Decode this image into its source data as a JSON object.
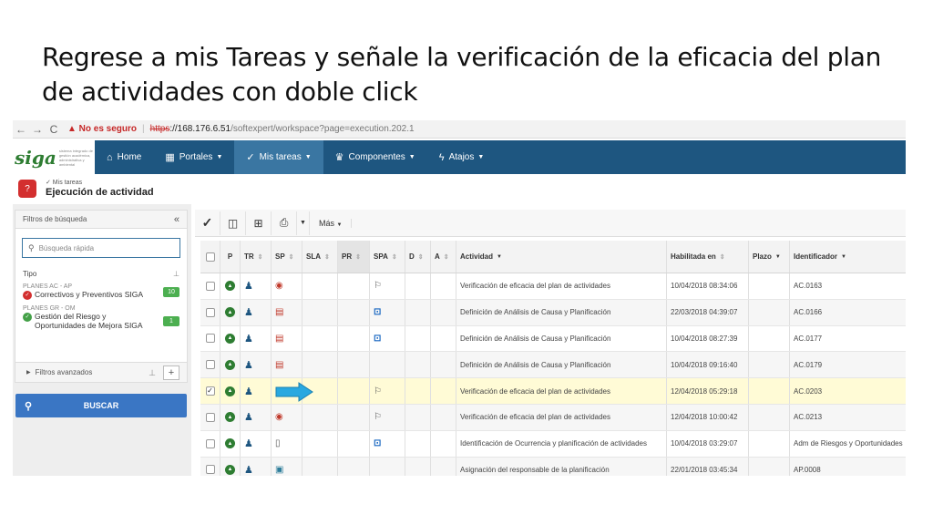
{
  "slide": {
    "title": "Regrese a mis Tareas y señale la verificación de la eficacia del plan de actividades con doble click"
  },
  "browser": {
    "back": "←",
    "forward": "→",
    "reload": "C",
    "security_warning": "▲ No es seguro",
    "separator": "|",
    "url_scheme": "https",
    "url_host": "://168.176.6.51",
    "url_path": "/softexpert/workspace?page=execution.202.1"
  },
  "nav": {
    "logo": "siga",
    "logo_subtitle": "sistema integrado de gestión académica, administrativa y ambiental",
    "items": [
      {
        "label": "Home",
        "icon": "home-icon",
        "glyph": "⌂"
      },
      {
        "label": "Portales",
        "icon": "grid-icon",
        "glyph": "▦"
      },
      {
        "label": "Mis tareas",
        "icon": "check-icon",
        "glyph": "✓"
      },
      {
        "label": "Componentes",
        "icon": "trophy-icon",
        "glyph": "♛"
      },
      {
        "label": "Atajos",
        "icon": "bolt-icon",
        "glyph": "ϟ"
      }
    ]
  },
  "breadcrumb": {
    "parent": "✓ Mis tareas",
    "title": "Ejecución de actividad"
  },
  "filters": {
    "header": "Filtros de búsqueda",
    "collapse": "«",
    "search_placeholder": "Búsqueda rápida",
    "tipo_label": "Tipo",
    "groups": [
      {
        "label": "PLANES AC - AP",
        "name": "Correctivos y Preventivos SIGA",
        "count": "10",
        "status": "red"
      },
      {
        "label": "PLANES GR - OM",
        "name": "Gestión del Riesgo y Oportunidades de Mejora SIGA",
        "count": "1",
        "status": "green"
      }
    ],
    "advanced": "Filtros avanzados",
    "search_button": "BUSCAR"
  },
  "toolbar": {
    "more_label": "Más"
  },
  "table": {
    "headers": {
      "p": "P",
      "tr": "TR",
      "sp": "SP",
      "sla": "SLA",
      "pr": "PR",
      "spa": "SPA",
      "d": "D",
      "a": "A",
      "actividad": "Actividad",
      "habilitada": "Habilitada en",
      "plazo": "Plazo",
      "identificador": "Identificador"
    },
    "rows": [
      {
        "sp": "eye",
        "spa": "flag",
        "actividad": "Verificación de eficacia del plan de actividades",
        "habilitada": "10/04/2018 08:34:06",
        "identificador": "AC.0163",
        "checked": false
      },
      {
        "sp": "calendar",
        "spa": "grid",
        "actividad": "Definición de Análisis de Causa y Planificación",
        "habilitada": "22/03/2018 04:39:07",
        "identificador": "AC.0166",
        "checked": false
      },
      {
        "sp": "calendar",
        "spa": "grid",
        "actividad": "Definición de Análisis de Causa y Planificación",
        "habilitada": "10/04/2018 08:27:39",
        "identificador": "AC.0177",
        "checked": false
      },
      {
        "sp": "calendar",
        "spa": "",
        "actividad": "Definición de Análisis de Causa y Planificación",
        "habilitada": "10/04/2018 09:16:40",
        "identificador": "AC.0179",
        "checked": false
      },
      {
        "sp": "arrow",
        "spa": "flag",
        "actividad": "Verificación de eficacia del plan de actividades",
        "habilitada": "12/04/2018 05:29:18",
        "identificador": "AC.0203",
        "checked": true
      },
      {
        "sp": "eye",
        "spa": "flag",
        "actividad": "Verificación de eficacia del plan de actividades",
        "habilitada": "12/04/2018 10:00:42",
        "identificador": "AC.0213",
        "checked": false
      },
      {
        "sp": "clipboard",
        "spa": "grid",
        "actividad": "Identificación de Ocurrencia y planificación de actividades",
        "habilitada": "10/04/2018 03:29:07",
        "identificador": "Adm de Riesgos y Oportunidades",
        "checked": false
      },
      {
        "sp": "screen",
        "spa": "",
        "actividad": "Asignación del responsable de la planificación",
        "habilitada": "22/01/2018 03:45:34",
        "identificador": "AP.0008",
        "checked": false
      }
    ]
  },
  "colors": {
    "nav_bg": "#1e5680",
    "nav_active": "#3a76a2",
    "button_blue": "#3a76c4",
    "selected_row": "#fffbd6",
    "arrow_fill": "#29a8e0"
  }
}
